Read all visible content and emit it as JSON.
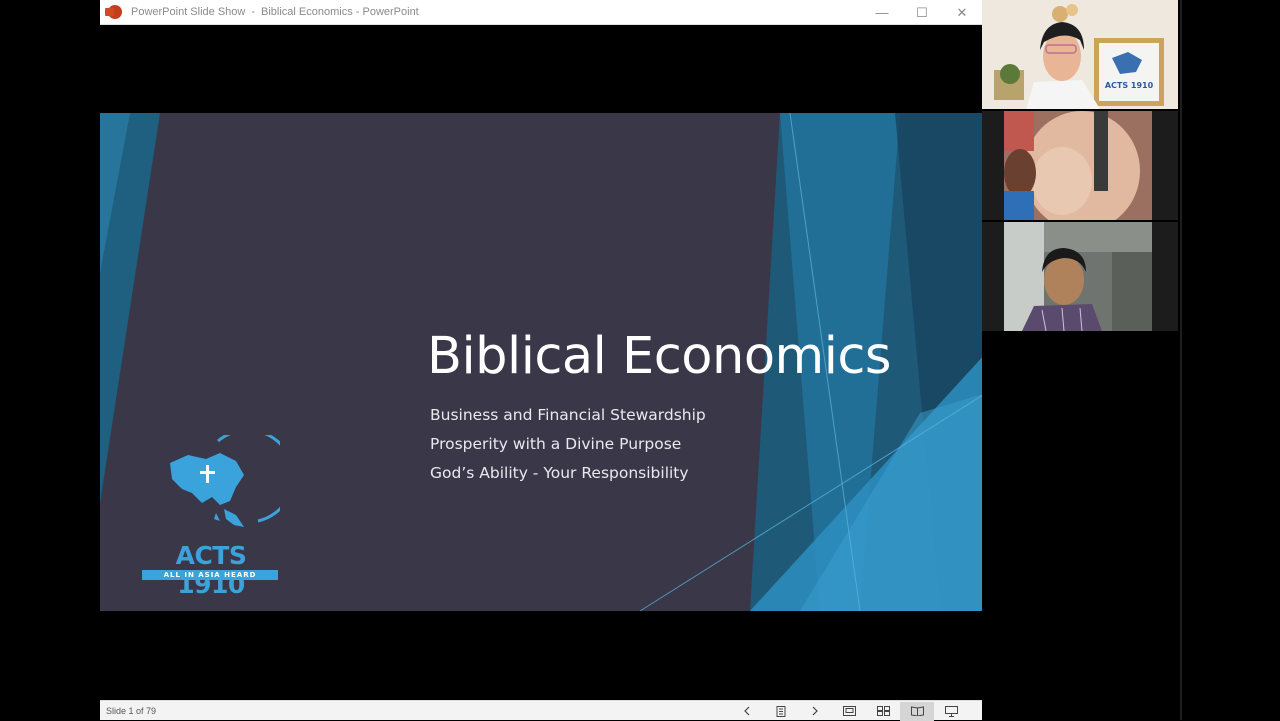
{
  "window": {
    "app_name": "PowerPoint Slide Show",
    "separator": "-",
    "document_title": "Biblical Economics - PowerPoint",
    "minimize": "—",
    "maximize": "☐",
    "close": "✕"
  },
  "slide": {
    "title": "Biblical Economics",
    "subtitles": [
      "Business and Financial Stewardship",
      "Prosperity with a Divine Purpose",
      "God’s Ability - Your Responsibility"
    ],
    "logo": {
      "name": "ACTS 1910",
      "tagline": "ALL IN ASIA HEARD"
    },
    "colors": {
      "background": "#3a3848",
      "accent_dark": "#1e5a78",
      "accent_light": "#2d8fc0",
      "logo_blue": "#3aa3dc"
    }
  },
  "statusbar": {
    "slide_counter": "Slide 1 of 79",
    "icons": [
      "chevron-left-icon",
      "slides-menu-icon",
      "chevron-right-icon",
      "normal-view-icon",
      "slide-sorter-icon",
      "reading-view-icon",
      "slideshow-icon"
    ]
  },
  "participants": [
    {
      "name": "participant-1"
    },
    {
      "name": "participant-2"
    },
    {
      "name": "participant-3"
    }
  ]
}
